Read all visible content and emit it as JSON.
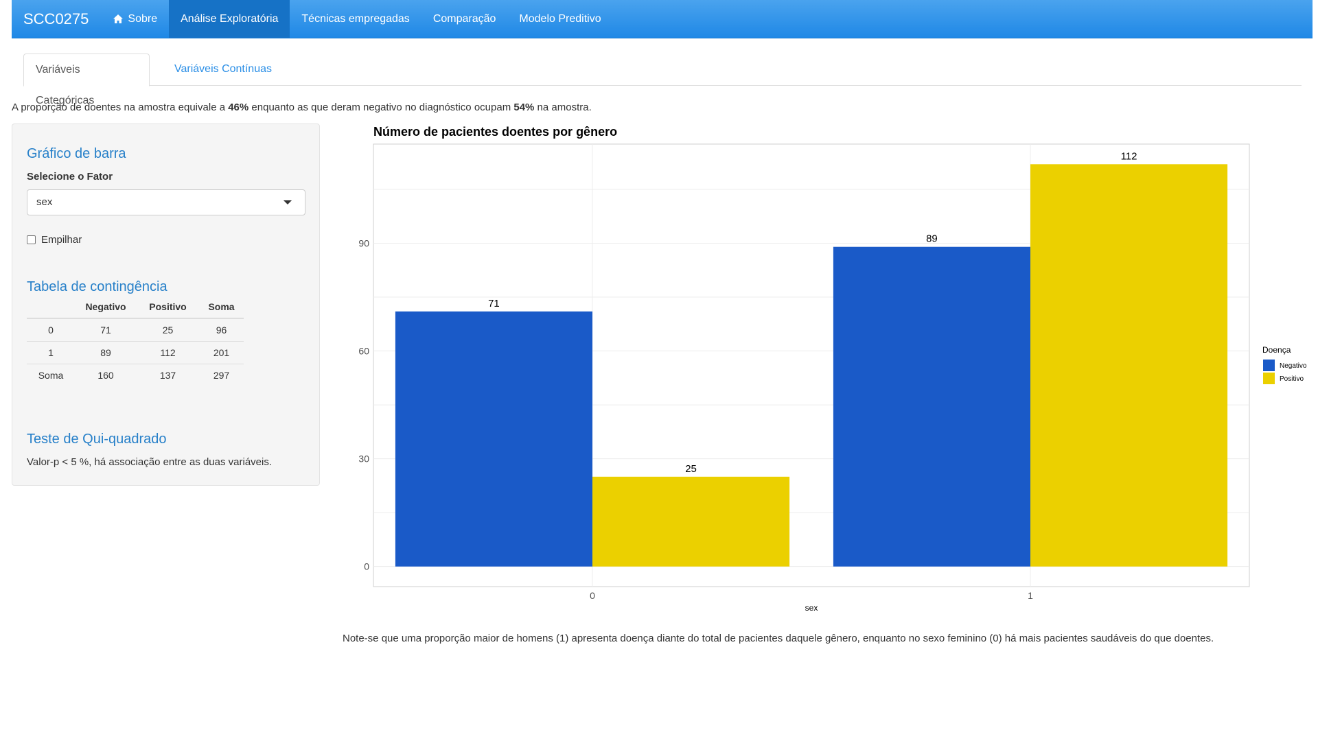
{
  "navbar": {
    "brand": "SCC0275",
    "items": [
      {
        "label": "Sobre",
        "icon": "home-icon",
        "active": false
      },
      {
        "label": "Análise Exploratória",
        "active": true
      },
      {
        "label": "Técnicas empregadas",
        "active": false
      },
      {
        "label": "Comparação",
        "active": false
      },
      {
        "label": "Modelo Preditivo",
        "active": false
      }
    ]
  },
  "tabs": [
    {
      "label": "Variáveis Categóricas",
      "active": true
    },
    {
      "label": "Variáveis Contínuas",
      "active": false
    }
  ],
  "intro": {
    "before": "A proporção de doentes na amostra equivale a ",
    "pct_sick": "46%",
    "middle": " enquanto as que deram negativo no diagnóstico ocupam ",
    "pct_healthy": "54%",
    "after": " na amostra."
  },
  "sidebar": {
    "bar_title": "Gráfico de barra",
    "select_label": "Selecione o Fator",
    "select_value": "sex",
    "checkbox_label": "Empilhar",
    "checkbox_checked": false,
    "table_title": "Tabela de contingência",
    "table": {
      "headers": [
        "",
        "Negativo",
        "Positivo",
        "Soma"
      ],
      "rows": [
        [
          "0",
          "71",
          "25",
          "96"
        ],
        [
          "1",
          "89",
          "112",
          "201"
        ],
        [
          "Soma",
          "160",
          "137",
          "297"
        ]
      ]
    },
    "chi_title": "Teste de Qui-quadrado",
    "chi_text": "Valor-p < 5 %, há associação entre as duas variáveis."
  },
  "chart_data": {
    "type": "bar",
    "title": "Número de pacientes doentes por gênero",
    "xlabel": "sex",
    "ylabel": "",
    "categories": [
      "0",
      "1"
    ],
    "series": [
      {
        "name": "Negativo",
        "values": [
          71,
          89
        ],
        "color": "#1a5ac8"
      },
      {
        "name": "Positivo",
        "values": [
          25,
          112
        ],
        "color": "#ebd000"
      }
    ],
    "yticks": [
      0,
      30,
      60,
      90
    ],
    "ylim": [
      -5.6,
      117.6
    ],
    "legend_title": "Doença",
    "legend_position": "right",
    "grid": true
  },
  "note": "Note-se que uma proporção maior de homens (1) apresenta doença diante do total de pacientes daquele gênero, enquanto no sexo feminino (0) há mais pacientes saudáveis do que doentes."
}
